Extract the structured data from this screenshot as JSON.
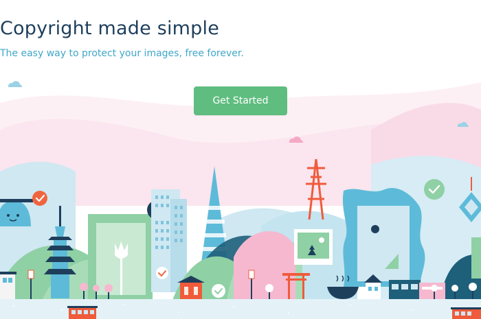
{
  "hero": {
    "title": "Copyright made simple",
    "subtitle": "The easy way to protect your images, free forever.",
    "cta_label": "Get Started"
  },
  "colors": {
    "title": "#1e3f5c",
    "subtitle": "#3fa7c9",
    "cta_background": "#5fbd7f",
    "cta_text": "#ffffff",
    "sky_pink": "#fbe4ee",
    "hill_blue": "#cfe8f2",
    "hill_green": "#8fd0a5",
    "check_green": "#6ccf8b",
    "check_orange": "#f0653f",
    "tower_red": "#ef5b3b",
    "frame_blue": "#5dbbd9"
  },
  "illustration": {
    "icons": [
      "cloud-icon",
      "checkmark-badge-icon",
      "transamerica-tower-icon",
      "sutro-tower-icon",
      "pagoda-icon",
      "torii-gate-icon",
      "picture-frame-icon",
      "image-placeholder-icon",
      "tulip-icon",
      "cable-car-icon",
      "ramen-bowl-icon",
      "robot-face-icon",
      "lantern-icon"
    ]
  }
}
